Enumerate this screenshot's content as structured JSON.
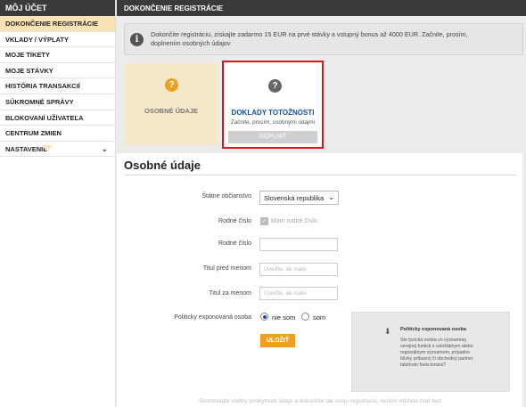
{
  "sidebar": {
    "title": "MÔJ ÚČET",
    "items": [
      {
        "label": "DOKONČENIE REGISTRÁCIE"
      },
      {
        "label": "VKLADY / VÝPLATY"
      },
      {
        "label": "MOJE TIKETY"
      },
      {
        "label": "MOJE STÁVKY"
      },
      {
        "label": "HISTÓRIA TRANSAKCIÍ"
      },
      {
        "label": "SÚKROMNÉ SPRÁVY"
      },
      {
        "label": "BLOKOVANÍ UŽÍVATEĽA"
      },
      {
        "label": "CENTRUM ZMIEN"
      },
      {
        "label": "NASTAVENIE"
      }
    ]
  },
  "header": {
    "title": "DOKONČENIE REGISTRÁCIE"
  },
  "info": {
    "icon": "info-icon",
    "text_line1": "Dokončite registráciu, získajte zadarmo 15 EUR na prvé stávky a vstupný bonus až 4000 EUR. Začnite, prosím,",
    "text_line2": "doplnením osobných údajov"
  },
  "steps": {
    "personal": {
      "label": "OSOBNÉ ÚDAJE",
      "icon": "question-icon"
    },
    "documents": {
      "title": "DOKLADY TOTOŽNOSTI",
      "subtitle": "Začnite, prosím, osobnými údajmi",
      "button": "DOPLNIŤ",
      "icon": "question-icon"
    }
  },
  "form": {
    "section_title": "Osobné údaje",
    "citizenship": {
      "label": "Štátne občianstvo",
      "value": "Slovenská republika"
    },
    "birth_number_checkbox": {
      "label": "Rodné číslo",
      "checkbox_label": "Mám rodné číslo"
    },
    "birth_number": {
      "label": "Rodné číslo",
      "value": ""
    },
    "title_before": {
      "label": "Titul pred menom",
      "placeholder": "Uveďte, ak máte"
    },
    "title_after": {
      "label": "Titul za menom",
      "placeholder": "Uveďte, ak máte"
    },
    "pep": {
      "label": "Politicky exponovaná osoba",
      "option_no": "nie som",
      "option_yes": "som",
      "selected": "nie som"
    },
    "save_button": "ULOŽIŤ"
  },
  "side_note": {
    "title": "Politicky exponovaná osoba",
    "text": "Ste fyzická osoba vo významnej verejnej funkcii s celoštátnym alebo regionálnym významom, prípadne blízky príbuzný či obchodný partner takéhoto funkcionára?"
  },
  "footer": {
    "text": "Skontrolujte všetky poskytnuté údaje a dokončite tak svoju registráciu, neskôr môžete hrať bez"
  },
  "colors": {
    "accent": "#f0a020",
    "highlight": "#e0131a",
    "link": "#1a4e9a",
    "active_bg": "#f7e2b5"
  }
}
